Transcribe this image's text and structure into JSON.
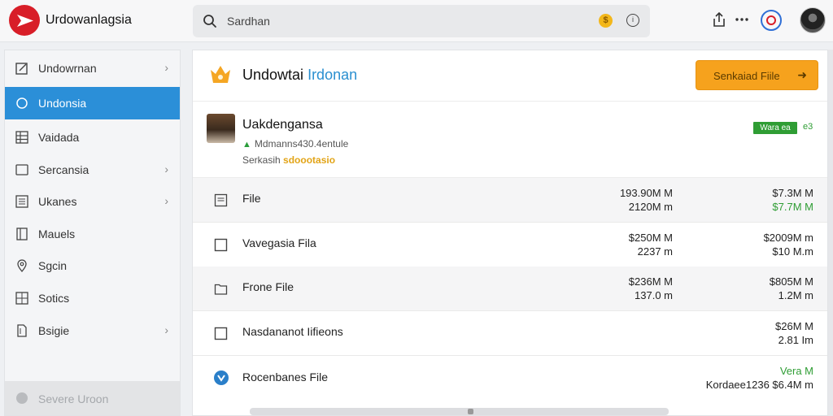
{
  "app": {
    "title": "Urdowanlagsia"
  },
  "search": {
    "placeholder": "Sardhan"
  },
  "sidebar": {
    "items": [
      {
        "label": "Undowrnan",
        "icon": "edit-icon",
        "chevron": "›"
      },
      {
        "label": "Undonsia",
        "icon": "circle-icon",
        "chevron": ""
      },
      {
        "label": "Vaidada",
        "icon": "table-icon",
        "chevron": ""
      },
      {
        "label": "Sercansia",
        "icon": "square-icon",
        "chevron": "›"
      },
      {
        "label": "Ukanes",
        "icon": "list-icon",
        "chevron": "›"
      },
      {
        "label": "Mauels",
        "icon": "book-icon",
        "chevron": ""
      },
      {
        "label": "Sgcin",
        "icon": "location-icon",
        "chevron": ""
      },
      {
        "label": "Sotics",
        "icon": "grid-icon",
        "chevron": ""
      },
      {
        "label": "Bsigie",
        "icon": "document-icon",
        "chevron": "›"
      }
    ],
    "footer_label": "Severe Uroon"
  },
  "main": {
    "title_part1": "Undowtai",
    "title_part2": "Irdonan",
    "primary_button": {
      "label": "Senkaiad Fiile",
      "arrow": "➜"
    },
    "profile": {
      "name": "Uakdengansa",
      "subtitle": "Mdmanns430.4entule",
      "meta_label": "Serkasih",
      "meta_highlight": "sdoootasio",
      "badge": "Wara ea",
      "badge_extra": "e3"
    },
    "rows": [
      {
        "name": "File",
        "icon": "file-icon",
        "v1a": "193.90M M",
        "v1b": "2120M m",
        "v2a": "$7.3M M",
        "v2b": "$7.7M M",
        "v2b_green": true,
        "v2a_green": false
      },
      {
        "name": "Vavegasia Fila",
        "icon": "square-icon",
        "v1a": "$250M M",
        "v1b": "2237 m",
        "v2a": "$2009M m",
        "v2b": "$10 M.m",
        "v2b_green": false,
        "v2a_green": false
      },
      {
        "name": "Frone File",
        "icon": "folder-icon",
        "v1a": "$236M M",
        "v1b": "137.0 m",
        "v2a": "$805M M",
        "v2b": "1.2M m",
        "v2b_green": false,
        "v2a_green": false
      },
      {
        "name": "Nasdananot Iifieons",
        "icon": "square-icon",
        "v1a": "",
        "v1b": "",
        "v2a": "$26M M",
        "v2b": "2.81 Im",
        "v2b_green": false,
        "v2a_green": false
      },
      {
        "name": "Rocenbanes File",
        "icon": "blue-circle-icon",
        "v1a": "",
        "v1b": "",
        "v2a": "Vera M",
        "v2b": "Kordaee1236 $6.4M m",
        "v2b_green": false,
        "v2a_green": true
      }
    ]
  },
  "colors": {
    "accent": "#2b8fd8",
    "brand": "#d81e28",
    "button": "#f6a21d",
    "success": "#2f9d34"
  }
}
